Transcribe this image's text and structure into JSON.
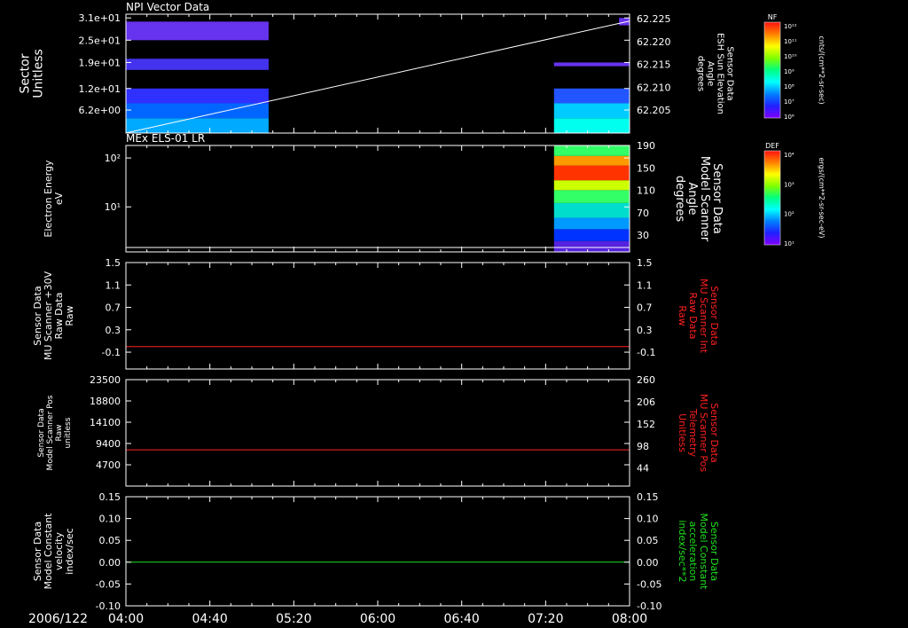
{
  "date_label": "2006/122",
  "time_ticks": [
    "04:00",
    "04:40",
    "05:20",
    "06:00",
    "06:40",
    "07:20",
    "08:00"
  ],
  "colors": {
    "axis": "#ffffff",
    "red": "#ff2020",
    "green": "#20e020",
    "cyan": "#00ffff"
  },
  "colorbars": [
    {
      "title": "NF",
      "unit": "cnts/(cm**2-sr-sec)",
      "tick_labels": [
        "10¹²",
        "10¹¹",
        "10¹⁰",
        "10⁹",
        "10⁸",
        "10⁷",
        "10⁶"
      ]
    },
    {
      "title": "DEF",
      "unit": "ergs/(cm**2-sr-sec-eV)",
      "tick_labels": [
        "10⁴",
        "10³",
        "10²",
        "10¹"
      ]
    }
  ],
  "chart_data": [
    {
      "type": "heatmap",
      "title": "NPI Vector Data",
      "ylabel": [
        "Sector",
        "Unitless"
      ],
      "ytick_labels": [
        "3.1e+01",
        "2.5e+01",
        "1.9e+01",
        "1.2e+01",
        "6.2e+00"
      ],
      "yticks": [
        31,
        25,
        19,
        12,
        6.2
      ],
      "ylim": [
        0,
        32
      ],
      "y2label": [
        "Sensor Data",
        "ESH Sun Elevation",
        "Angle",
        "degrees"
      ],
      "y2tick_labels": [
        "62.225",
        "62.220",
        "62.215",
        "62.210",
        "62.205"
      ],
      "y2ticks": [
        62.225,
        62.22,
        62.215,
        62.21,
        62.205
      ],
      "y2lim": [
        62.2,
        62.226
      ],
      "line": {
        "x": [
          "04:00",
          "08:00"
        ],
        "y2": [
          62.2,
          62.2245
        ]
      },
      "blocks": [
        {
          "t0": "04:00",
          "t1": "05:08",
          "y0": 0,
          "y1": 4,
          "color": "#00aaff"
        },
        {
          "t0": "04:00",
          "t1": "05:08",
          "y0": 4,
          "y1": 8,
          "color": "#0066ff"
        },
        {
          "t0": "04:00",
          "t1": "05:08",
          "y0": 8,
          "y1": 12,
          "color": "#3030ff"
        },
        {
          "t0": "04:00",
          "t1": "05:08",
          "y0": 17,
          "y1": 20,
          "color": "#4433ee"
        },
        {
          "t0": "04:00",
          "t1": "05:08",
          "y0": 25,
          "y1": 30,
          "color": "#6633ee"
        },
        {
          "t0": "07:24",
          "t1": "08:00",
          "y0": 0,
          "y1": 4,
          "color": "#00ffee"
        },
        {
          "t0": "07:24",
          "t1": "08:00",
          "y0": 4,
          "y1": 8,
          "color": "#00ccff"
        },
        {
          "t0": "07:24",
          "t1": "08:00",
          "y0": 8,
          "y1": 12,
          "color": "#2255ff"
        },
        {
          "t0": "07:24",
          "t1": "08:00",
          "y0": 18,
          "y1": 19,
          "color": "#6633ee"
        },
        {
          "t0": "07:55",
          "t1": "08:00",
          "y0": 29,
          "y1": 31,
          "color": "#6633ee"
        }
      ]
    },
    {
      "type": "heatmap",
      "title": "MEx ELS-01 LR",
      "ylabel": [
        "Electron Energy",
        "eV"
      ],
      "ytick_labels": [
        "10²",
        "10¹"
      ],
      "yticks": [
        100,
        10
      ],
      "ylog": true,
      "ylim": [
        1.2,
        180
      ],
      "y2label": [
        "Sensor Data",
        "Model Scanner",
        "Angle",
        "degrees"
      ],
      "y2tick_labels": [
        "190",
        "150",
        "110",
        "70",
        "30"
      ],
      "y2ticks": [
        190,
        150,
        110,
        70,
        30
      ],
      "y2lim": [
        0,
        190
      ],
      "line": {
        "x": [
          "04:00",
          "08:00"
        ],
        "y2": [
          8,
          8
        ]
      },
      "blocks": [
        {
          "t0": "07:24",
          "t1": "08:00",
          "ylo": 1.2,
          "yhi": 2.0,
          "color": "#5522dd"
        },
        {
          "t0": "07:24",
          "t1": "08:00",
          "ylo": 2.0,
          "yhi": 3.5,
          "color": "#0033ff"
        },
        {
          "t0": "07:24",
          "t1": "08:00",
          "ylo": 3.5,
          "yhi": 6,
          "color": "#0099ff"
        },
        {
          "t0": "07:24",
          "t1": "08:00",
          "ylo": 6,
          "yhi": 12,
          "color": "#00ddcc"
        },
        {
          "t0": "07:24",
          "t1": "08:00",
          "ylo": 12,
          "yhi": 22,
          "color": "#33ff66"
        },
        {
          "t0": "07:24",
          "t1": "08:00",
          "ylo": 22,
          "yhi": 35,
          "color": "#ccff00"
        },
        {
          "t0": "07:24",
          "t1": "08:00",
          "ylo": 35,
          "yhi": 70,
          "color": "#ff3300"
        },
        {
          "t0": "07:24",
          "t1": "08:00",
          "ylo": 70,
          "yhi": 110,
          "color": "#ff9900"
        },
        {
          "t0": "07:24",
          "t1": "08:00",
          "ylo": 110,
          "yhi": 180,
          "color": "#33ff66"
        }
      ]
    },
    {
      "type": "line",
      "ylabel": [
        "Sensor Data",
        "MU Scanner +30V",
        "Raw Data",
        "Raw"
      ],
      "ytick_labels": [
        "1.5",
        "1.1",
        "0.7",
        "0.3",
        "-0.1"
      ],
      "yticks": [
        1.5,
        1.1,
        0.7,
        0.3,
        -0.1
      ],
      "ylim": [
        -0.4,
        1.5
      ],
      "y2label": [
        "Sensor Data",
        "MU Scanner Int",
        "Raw Data",
        "Raw"
      ],
      "y2tick_labels": [
        "1.5",
        "1.1",
        "0.7",
        "0.3",
        "-0.1"
      ],
      "y2ticks": [
        1.5,
        1.1,
        0.7,
        0.3,
        -0.1
      ],
      "y2lim": [
        -0.4,
        1.5
      ],
      "series": [
        {
          "x": [
            "04:00",
            "08:00"
          ],
          "y": [
            0,
            0
          ],
          "color": "#ff2020"
        }
      ]
    },
    {
      "type": "line",
      "ylabel": [
        "Sensor Data",
        "Model Scanner Pos",
        "Raw",
        "unitless"
      ],
      "ytick_labels": [
        "23500",
        "18800",
        "14100",
        "9400",
        "4700"
      ],
      "yticks": [
        23500,
        18800,
        14100,
        9400,
        4700
      ],
      "ylim": [
        0,
        23500
      ],
      "y2label": [
        "Sensor Data",
        "MU Scanner Pos",
        "Telemetry",
        "Unitless"
      ],
      "y2tick_labels": [
        "260",
        "206",
        "152",
        "98",
        "44"
      ],
      "y2ticks": [
        260,
        206,
        152,
        98,
        44
      ],
      "y2lim": [
        0,
        260
      ],
      "series": [
        {
          "x": [
            "04:00",
            "08:00"
          ],
          "y": [
            8000,
            8000
          ],
          "color": "#ff2020"
        }
      ]
    },
    {
      "type": "line",
      "ylabel": [
        "Sensor Data",
        "Model Constant",
        "velocity",
        "index/sec"
      ],
      "ytick_labels": [
        "0.15",
        "0.10",
        "0.05",
        "0.00",
        "-0.05",
        "-0.10"
      ],
      "yticks": [
        0.15,
        0.1,
        0.05,
        0,
        -0.05,
        -0.1
      ],
      "ylim": [
        -0.1,
        0.15
      ],
      "y2label": [
        "Sensor Data",
        "Model Constant",
        "acceleration",
        "index/sec**2"
      ],
      "y2tick_labels": [
        "0.15",
        "0.10",
        "0.05",
        "0.00",
        "-0.05",
        "-0.10"
      ],
      "y2ticks": [
        0.15,
        0.1,
        0.05,
        0,
        -0.05,
        -0.1
      ],
      "y2lim": [
        -0.1,
        0.15
      ],
      "series": [
        {
          "x": [
            "04:00",
            "08:00"
          ],
          "y": [
            0,
            0
          ],
          "color": "#20e020"
        }
      ]
    }
  ]
}
